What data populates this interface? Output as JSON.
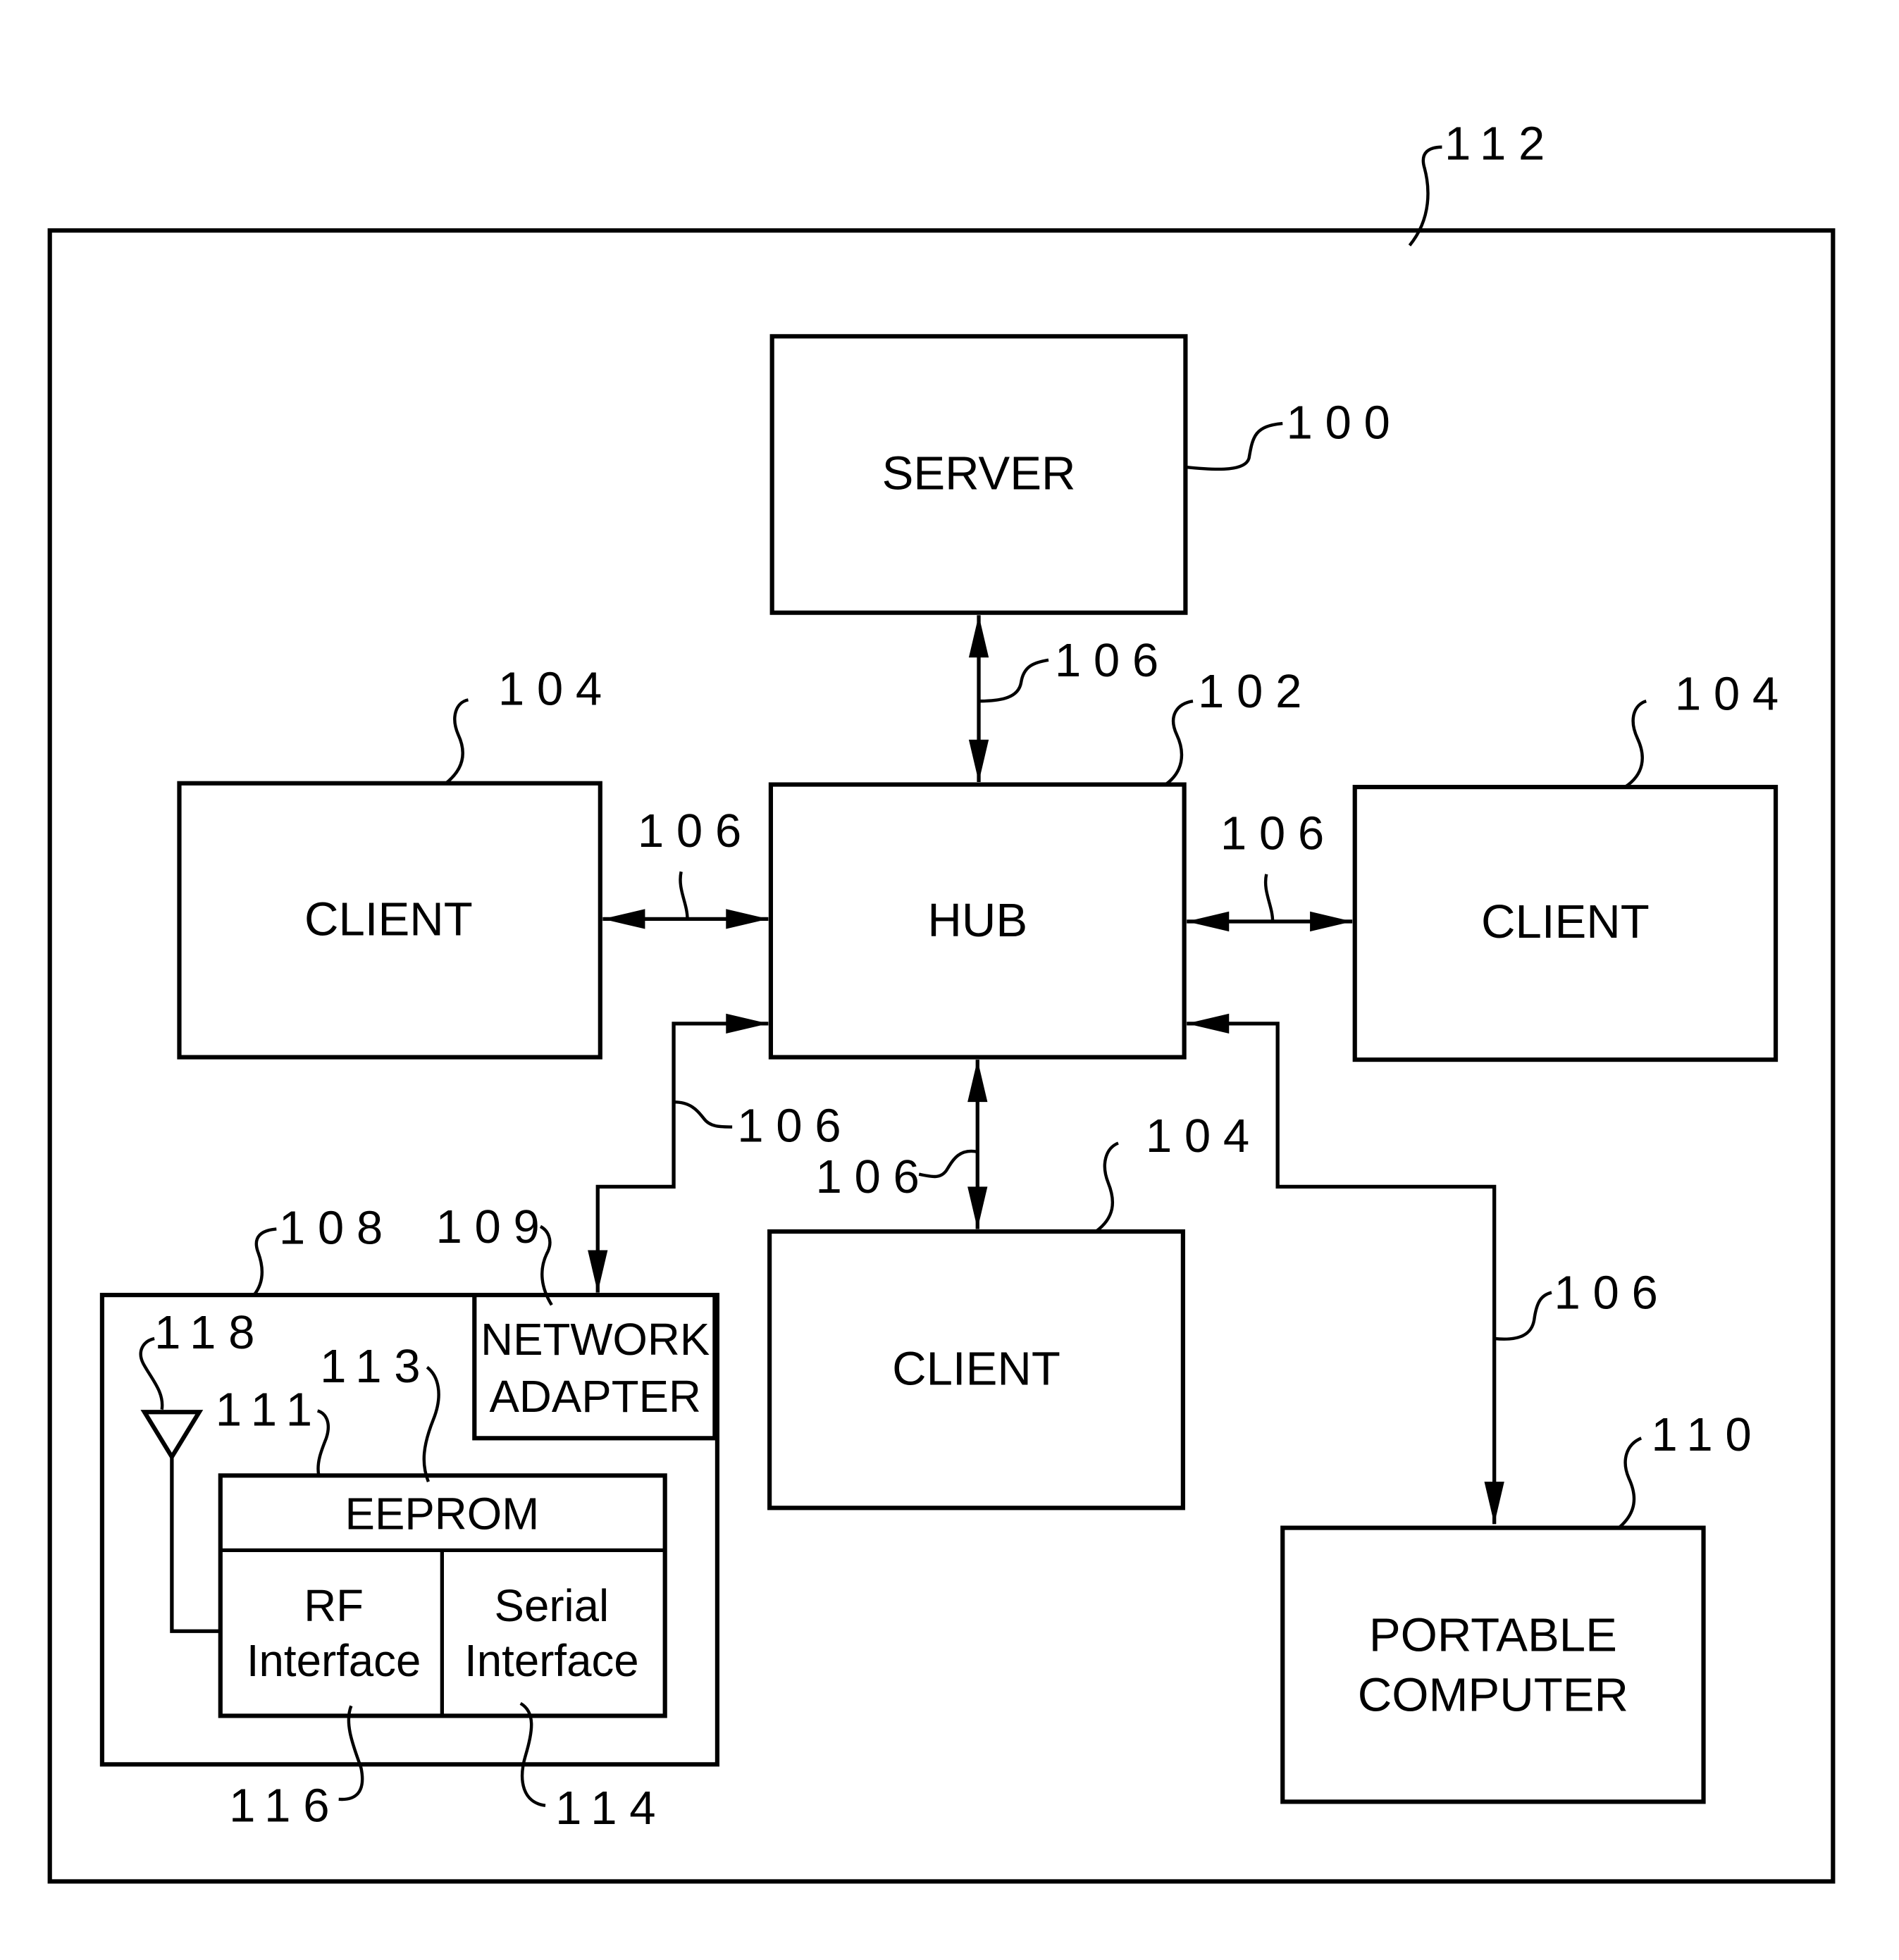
{
  "figure": {
    "system_ref": "112",
    "server": {
      "label": "SERVER",
      "ref": "100"
    },
    "hub": {
      "label": "HUB",
      "ref": "102"
    },
    "clients": [
      {
        "label": "CLIENT",
        "ref": "104",
        "position": "left"
      },
      {
        "label": "CLIENT",
        "ref": "104",
        "position": "right"
      },
      {
        "label": "CLIENT",
        "ref": "104",
        "position": "bottom"
      }
    ],
    "connection_ref": "106",
    "device": {
      "ref": "108",
      "network_adapter": {
        "label_line1": "NETWORK",
        "label_line2": "ADAPTER",
        "ref": "109"
      },
      "antenna_ref": "118",
      "module_ref": "111",
      "eeprom": {
        "label": "EEPROM",
        "ref": "113"
      },
      "rf_interface": {
        "label_line1": "RF",
        "label_line2": "Interface",
        "ref": "116"
      },
      "serial_interface": {
        "label_line1": "Serial",
        "label_line2": "Interface",
        "ref": "114"
      }
    },
    "portable_computer": {
      "label_line1": "PORTABLE",
      "label_line2": "COMPUTER",
      "ref": "110"
    }
  }
}
